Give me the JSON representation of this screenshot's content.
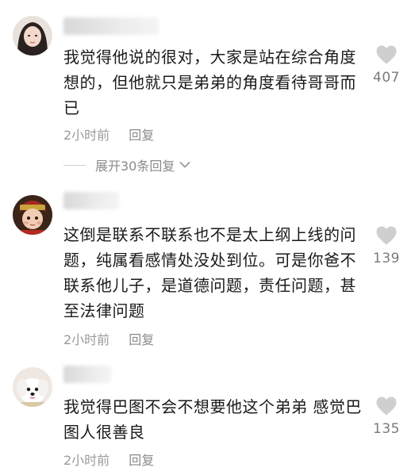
{
  "comments": [
    {
      "text": "我觉得他说的很对，大家是站在综合角度想的，但他就只是弟弟的角度看待哥哥而已",
      "time": "2小时前",
      "reply_label": "回复",
      "like_count": "407"
    },
    {
      "text": "这倒是联系不联系也不是太上纲上线的问题，纯属看感情处没处到位。可是你爸不联系他儿子，是道德问题，责任问题，甚至法律问题",
      "time": "2小时前",
      "reply_label": "回复",
      "like_count": "139"
    },
    {
      "text": "我觉得巴图不会不想要他这个弟弟 感觉巴图人很善良",
      "time": "2小时前",
      "reply_label": "回复",
      "like_count": "135"
    }
  ],
  "expand_replies": {
    "label": "展开30条回复"
  },
  "icons": {
    "like": "heart-icon",
    "expand": "chevron-down-icon"
  },
  "colors": {
    "text": "#1a1a1a",
    "secondary": "#9a9a9a",
    "heart": "#cfcfcf"
  }
}
